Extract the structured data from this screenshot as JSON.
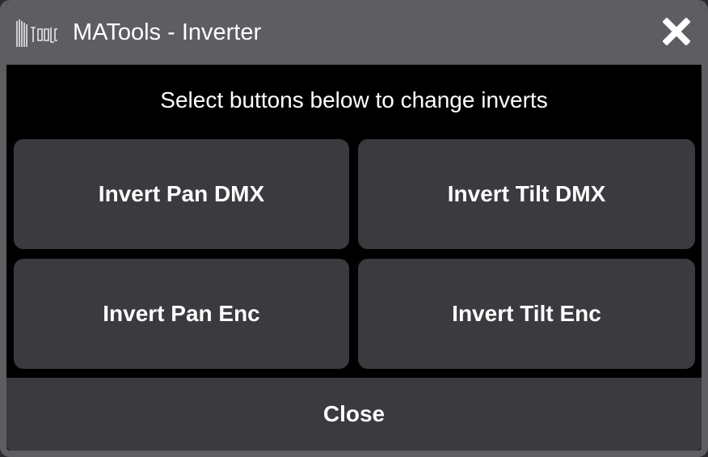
{
  "window": {
    "title": "MATools - Inverter",
    "logo_icon": "matools-logo-icon",
    "close_icon": "close-x-icon"
  },
  "instructions": "Select buttons below to change inverts",
  "buttons": [
    {
      "label": "Invert Pan DMX"
    },
    {
      "label": "Invert Tilt DMX"
    },
    {
      "label": "Invert Pan Enc"
    },
    {
      "label": "Invert Tilt Enc"
    }
  ],
  "footer": {
    "close_label": "Close"
  },
  "colors": {
    "titlebar": "#5d5d62",
    "button": "#3a3a3f",
    "background": "#000000",
    "text": "#ffffff"
  }
}
